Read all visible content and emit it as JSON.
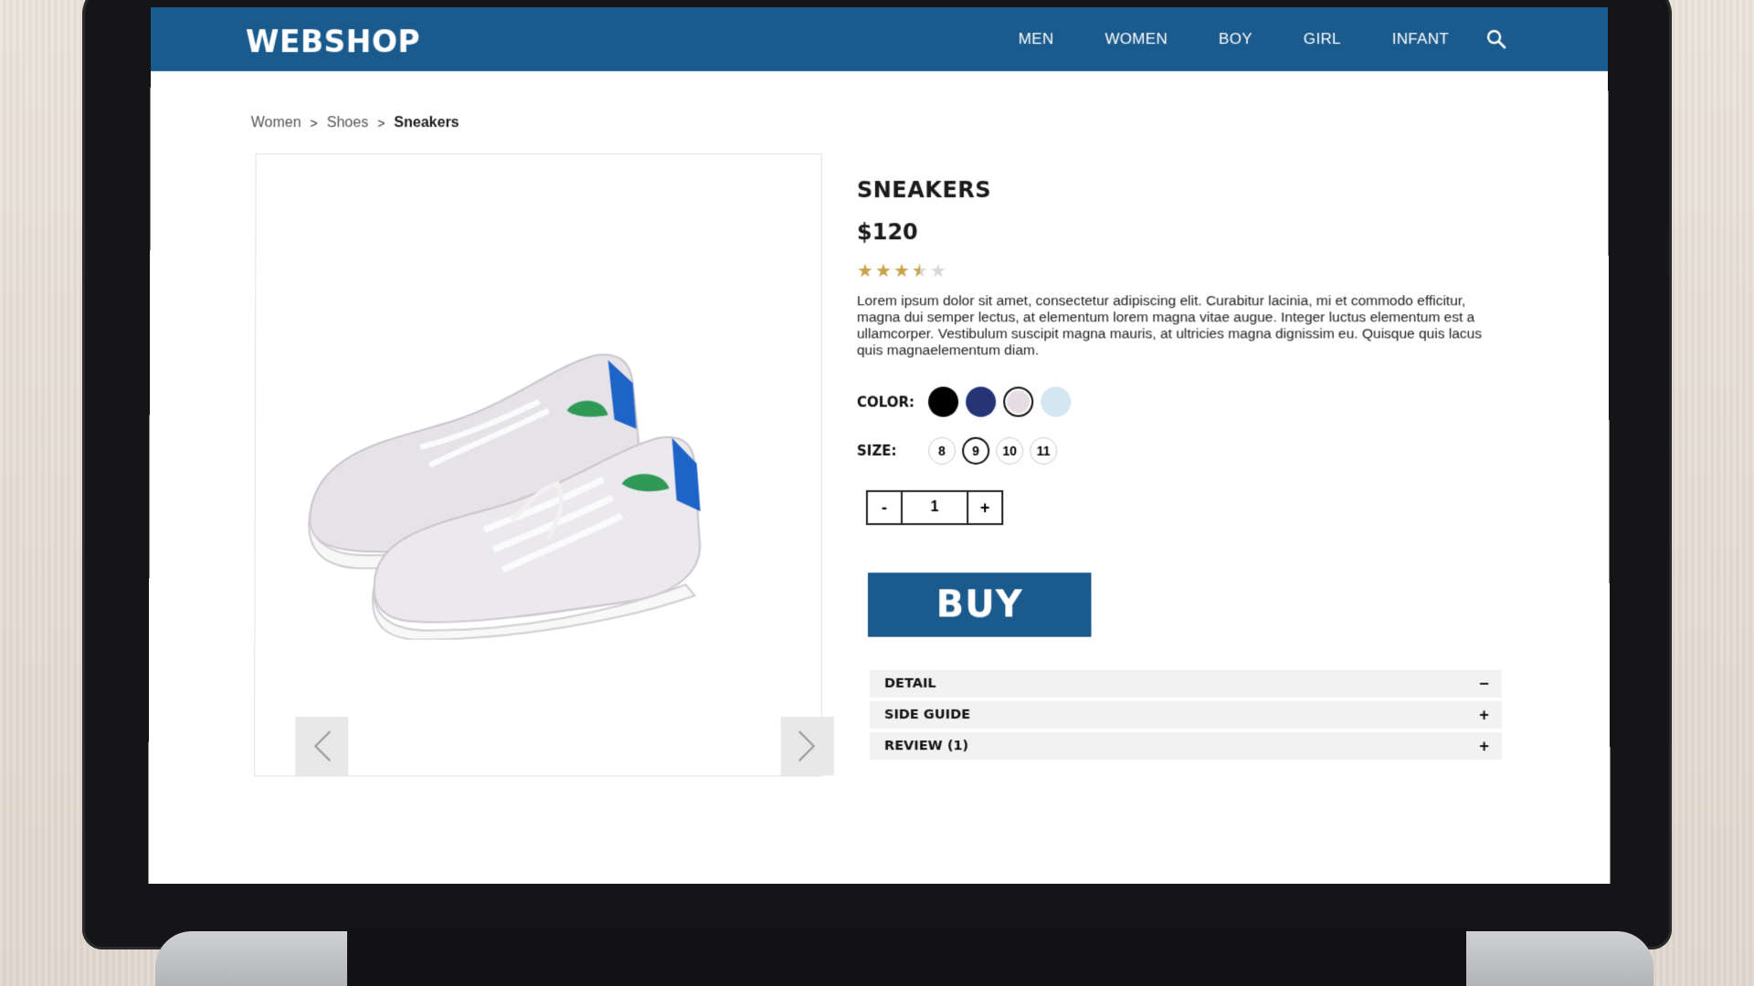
{
  "header": {
    "brand": "WEBSHOP",
    "nav": [
      "MEN",
      "WOMEN",
      "BOY",
      "GIRL",
      "INFANT"
    ]
  },
  "breadcrumb": {
    "items": [
      "Women",
      "Shoes",
      "Sneakers"
    ],
    "separator": ">"
  },
  "product": {
    "title": "SNEAKERS",
    "price": "$120",
    "rating": 3.5,
    "rating_max": 5,
    "description": "Lorem ipsum dolor sit amet, consectetur adipiscing elit. Curabitur lacinia, mi et commodo efficitur, magna dui semper lectus, at elementum lorem magna vitae augue. Integer luctus elementum est a ullamcorper. Vestibulum suscipit magna mauris, at ultricies magna dignissim eu. Quisque quis lacus quis magnaelementum diam.",
    "color_label": "COLOR:",
    "colors": [
      "#000000",
      "#253475",
      "#e6dde2",
      "#d4e6f0"
    ],
    "selected_color": 2,
    "size_label": "SIZE:",
    "sizes": [
      "8",
      "9",
      "10",
      "11"
    ],
    "selected_size": "9",
    "quantity": "1",
    "qty_minus": "-",
    "qty_plus": "+",
    "buy_label": "BUY"
  },
  "accordion": [
    {
      "label": "DETAIL",
      "toggle": "−"
    },
    {
      "label": "SIDE GUIDE",
      "toggle": "+"
    },
    {
      "label": "REVIEW (1)",
      "toggle": "+"
    }
  ],
  "colors": {
    "brand_blue": "#1a5a8c",
    "star_gold": "#c9a24a"
  },
  "icons": {
    "search": "search-icon",
    "prev": "chevron-left-icon",
    "next": "chevron-right-icon"
  }
}
